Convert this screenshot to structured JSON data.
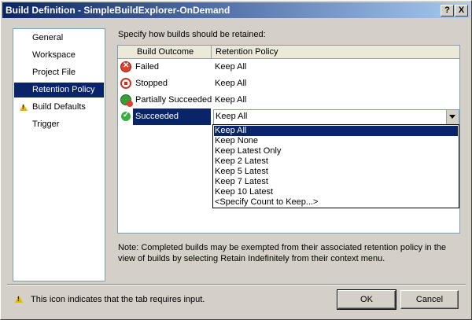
{
  "window": {
    "title": "Build Definition - SimpleBuildExplorer-OnDemand",
    "help_button": "?",
    "close_button": "X"
  },
  "sidebar": {
    "items": [
      {
        "label": "General",
        "icon": null,
        "selected": false
      },
      {
        "label": "Workspace",
        "icon": null,
        "selected": false
      },
      {
        "label": "Project File",
        "icon": null,
        "selected": false
      },
      {
        "label": "Retention Policy",
        "icon": null,
        "selected": true
      },
      {
        "label": "Build Defaults",
        "icon": "warning-icon",
        "selected": false
      },
      {
        "label": "Trigger",
        "icon": null,
        "selected": false
      }
    ]
  },
  "main": {
    "prompt": "Specify how builds should be retained:",
    "columns": [
      "Build Outcome",
      "Retention Policy"
    ],
    "rows": [
      {
        "icon": "failed-icon",
        "outcome": "Failed",
        "policy": "Keep All"
      },
      {
        "icon": "stopped-icon",
        "outcome": "Stopped",
        "policy": "Keep All"
      },
      {
        "icon": "partially-succeeded-icon",
        "outcome": "Partially Succeeded",
        "policy": "Keep All"
      },
      {
        "icon": "succeeded-icon",
        "outcome": "Succeeded",
        "policy": "Keep All",
        "selected": true
      }
    ],
    "dropdown": {
      "selected": "Keep All",
      "options": [
        "Keep All",
        "Keep None",
        "Keep Latest Only",
        "Keep 2 Latest",
        "Keep 5 Latest",
        "Keep 7 Latest",
        "Keep 10 Latest",
        "<Specify Count to Keep...>"
      ]
    },
    "note": "Note: Completed builds may be exempted from their associated retention policy in the view of builds by selecting Retain Indefinitely from their context menu."
  },
  "footer": {
    "warning_text": "This icon indicates that the tab requires input.",
    "ok_label": "OK",
    "cancel_label": "Cancel"
  },
  "colors": {
    "selection": "#0a246a",
    "dialog_bg": "#d4d0c8",
    "warning": "#e8b500"
  }
}
